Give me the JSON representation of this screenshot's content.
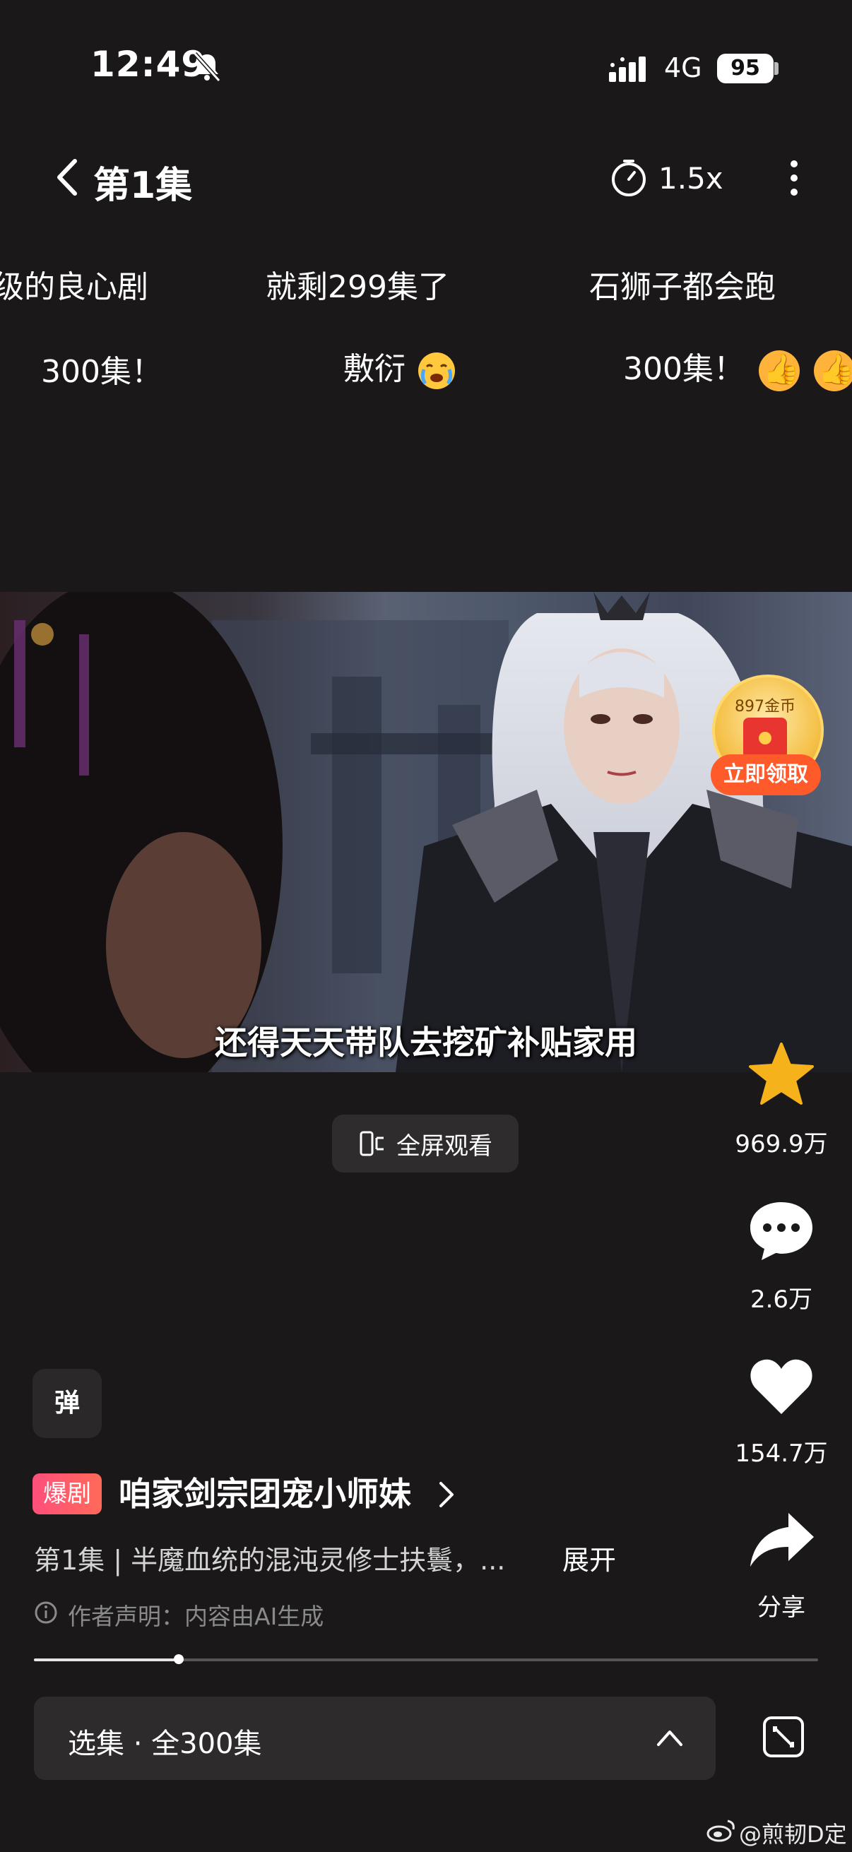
{
  "status_bar": {
    "time": "12:49",
    "network": "4G",
    "battery": "95"
  },
  "header": {
    "title": "第1集",
    "speed": "1.5x"
  },
  "danmaku": {
    "row1": [
      "级的良心剧",
      "就剩299集了",
      "石狮子都会跑"
    ],
    "row2": [
      "300集！",
      "敷衍",
      "300集！"
    ]
  },
  "video": {
    "subtitle": "还得天天带队去挖矿补贴家用"
  },
  "reward": {
    "amount": "897金币",
    "claim_label": "立即领取"
  },
  "actions": {
    "favorite_count": "969.9万",
    "comment_count": "2.6万",
    "like_count": "154.7万",
    "share_label": "分享"
  },
  "fullscreen_label": "全屏观看",
  "danmaku_toggle": "弹",
  "drama": {
    "badge": "爆剧",
    "title": "咱家剑宗团宠小师妹",
    "description": "第1集 | 半魔血统的混沌灵修士扶鬟，...",
    "expand": "展开",
    "ai_notice": "作者声明：内容由AI生成"
  },
  "progress": {
    "fraction": 0.185
  },
  "episode_selector": {
    "label": "选集 · 全300集"
  },
  "watermark": "@煎韧D定",
  "colors": {
    "background": "#1a1818",
    "favorite": "#f5b21b",
    "badge": "#ff4f7b",
    "claim": "#ff5a2a"
  }
}
